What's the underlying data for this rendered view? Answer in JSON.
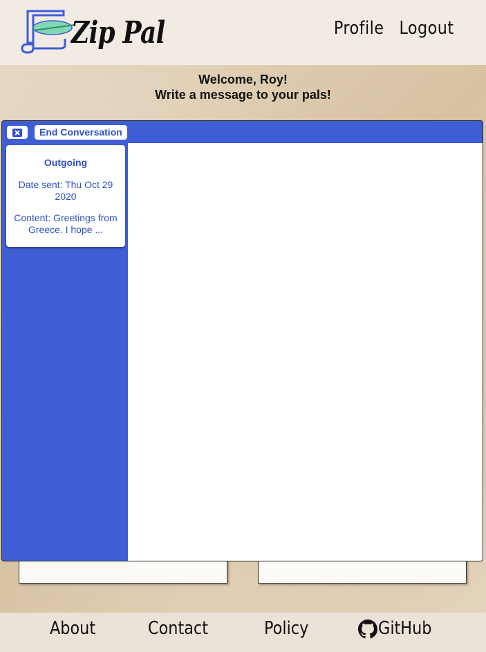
{
  "header": {
    "logo_text": "Zip Pal",
    "nav": {
      "profile": "Profile",
      "logout": "Logout"
    }
  },
  "welcome": {
    "line1": "Welcome, Roy!",
    "line2": "Write a message to your pals!"
  },
  "conversation": {
    "end_label": "End Conversation",
    "messages": [
      {
        "type": "Outgoing",
        "date": "Date sent: Thu Oct 29 2020",
        "content": "Content: Greetings from Greece. I hope ..."
      }
    ]
  },
  "footer": {
    "about": "About",
    "contact": "Contact",
    "policy": "Policy",
    "github": "GitHub"
  },
  "icons": {
    "close": "close-icon",
    "logo": "scroll-feather-icon",
    "github": "github-icon"
  },
  "colors": {
    "accent": "#3f5dd4",
    "accent_text": "#2f4fc7"
  }
}
